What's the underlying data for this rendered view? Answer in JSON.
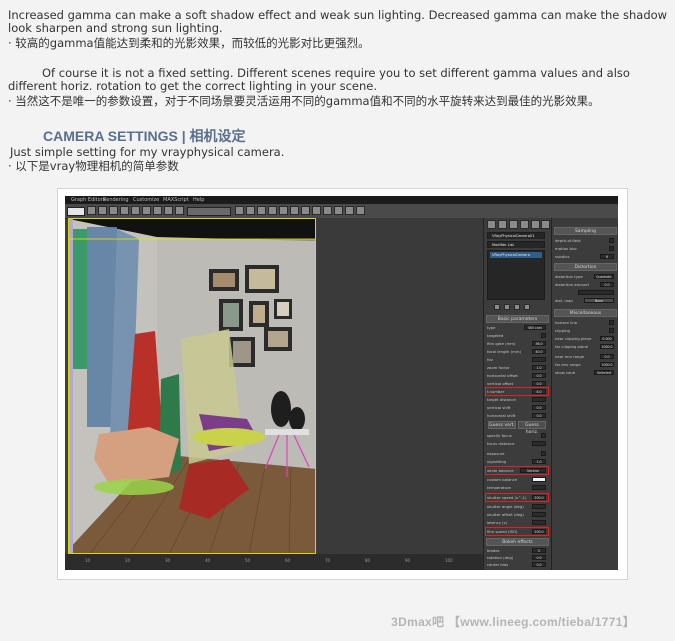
{
  "article": {
    "p1_en": "Increased gamma can make a soft shadow effect and weak sun lighting. Decreased gamma can make the shadow look sharpen and strong sun lighting.",
    "p1_cn": "· 较高的gamma值能达到柔和的光影效果，而较低的光影对比更强烈。",
    "p2_en": "Of course it is not a fixed setting. Different scenes require you to set different gamma values and also different horiz. rotation to get the correct lighting in your scene.",
    "p2_cn": "· 当然这不是唯一的参数设置，对于不同场景要灵活运用不同的gamma值和不同的水平旋转来达到最佳的光影效果。",
    "heading": "CAMERA SETTINGS | 相机设定",
    "p3_en": "Just simple setting for my vrayphysical camera.",
    "p3_cn": "· 以下是vray物理相机的简单参数"
  },
  "watermark": "3Dmax吧 【www.lineeg.com/tieba/1771】",
  "screenshot": {
    "menu": [
      "Graph Editors",
      "Rendering",
      "Customize",
      "MAXScript",
      "Help"
    ],
    "object_name": "VRayPhysicalCamera01",
    "modifier_list": "Modifier List",
    "stack_item": "VRayPhysicalCamera",
    "rollouts": {
      "basic": "Basic parameters",
      "bokeh": "Bokeh effects",
      "sampling": "Sampling",
      "distortion": "Distortion",
      "misc": "Miscellaneous"
    },
    "basic_params": [
      {
        "k": "type",
        "v": "Still cam"
      },
      {
        "k": "targeted",
        "v": ""
      },
      {
        "k": "film gate (mm)",
        "v": "36.0"
      },
      {
        "k": "focal length (mm)",
        "v": "40.0"
      },
      {
        "k": "fov",
        "v": ""
      },
      {
        "k": "zoom factor",
        "v": "1.0"
      },
      {
        "k": "horizontal offset",
        "v": "0.0"
      },
      {
        "k": "vertical offset",
        "v": "0.0"
      },
      {
        "k": "f-number",
        "v": "8.0"
      },
      {
        "k": "target distance",
        "v": ""
      },
      {
        "k": "vertical shift",
        "v": "0.0"
      },
      {
        "k": "horizontal shift",
        "v": "0.0"
      }
    ],
    "guess_buttons": [
      "Guess vert.",
      "Guess horiz."
    ],
    "focus_params": [
      {
        "k": "specify focus",
        "v": ""
      },
      {
        "k": "focus distance",
        "v": ""
      },
      {
        "k": "exposure",
        "v": ""
      },
      {
        "k": "vignetting",
        "v": "1.0"
      },
      {
        "k": "white balance",
        "v": "Neutral"
      },
      {
        "k": "custom balance",
        "v": ""
      },
      {
        "k": "temperature",
        "v": ""
      },
      {
        "k": "shutter speed (s^-1)",
        "v": "200.0"
      },
      {
        "k": "shutter angle (deg)",
        "v": ""
      },
      {
        "k": "shutter offset (deg)",
        "v": ""
      },
      {
        "k": "latency (s)",
        "v": ""
      },
      {
        "k": "film speed (ISO)",
        "v": "200.0"
      }
    ],
    "bokeh_params": [
      {
        "k": "blades",
        "v": "5"
      },
      {
        "k": "rotation (deg)",
        "v": "0.0"
      },
      {
        "k": "center bias",
        "v": "0.0"
      },
      {
        "k": "anisotropy",
        "v": "0.0"
      }
    ],
    "sampling_params": [
      {
        "k": "depth-of-field",
        "v": ""
      },
      {
        "k": "motion blur",
        "v": ""
      },
      {
        "k": "subdivs",
        "v": "6"
      }
    ],
    "distortion_params": [
      {
        "k": "distortion type",
        "v": "Quadratic"
      },
      {
        "k": "distortion amount",
        "v": "0.0"
      },
      {
        "k": "",
        "v": ""
      },
      {
        "k": "dist. map",
        "v": "None"
      }
    ],
    "misc_params": [
      {
        "k": "horizon line",
        "v": ""
      },
      {
        "k": "clipping",
        "v": ""
      },
      {
        "k": "near clipping plane",
        "v": "0.000"
      },
      {
        "k": "far clipping plane",
        "v": "1000.0"
      },
      {
        "k": "near env range",
        "v": "0.0"
      },
      {
        "k": "far env range",
        "v": "1000.0"
      },
      {
        "k": "show cone",
        "v": "Selected"
      }
    ],
    "ruler": [
      "10",
      "20",
      "30",
      "40",
      "50",
      "60",
      "70",
      "80",
      "90",
      "100"
    ]
  },
  "colors": {
    "heading": "#5a6f8c",
    "highlight": "#e42020",
    "selection": "#2e5e8e"
  }
}
